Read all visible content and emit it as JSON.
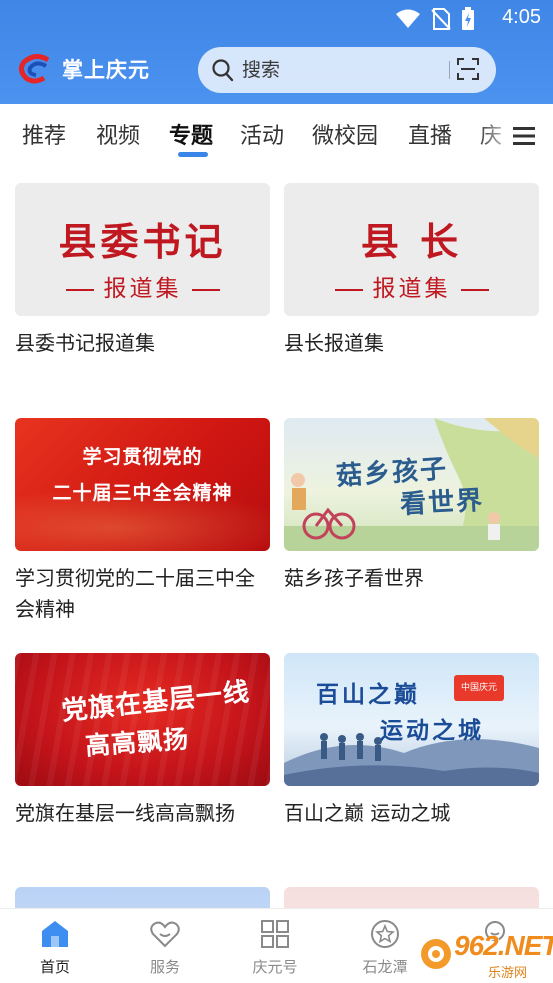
{
  "status_bar": {
    "time": "4:05"
  },
  "app": {
    "title": "掌上庆元"
  },
  "search": {
    "placeholder": "搜索"
  },
  "tabs": [
    {
      "label": "推荐"
    },
    {
      "label": "视频"
    },
    {
      "label": "专题",
      "active": true
    },
    {
      "label": "活动"
    },
    {
      "label": "微校园"
    },
    {
      "label": "直播"
    },
    {
      "label": "庆"
    }
  ],
  "cards": [
    {
      "title": "县委书记报道集",
      "thumb_main": "县委书记",
      "thumb_sub": "报道集"
    },
    {
      "title": "县长报道集",
      "thumb_main": "县 长",
      "thumb_sub": "报道集"
    },
    {
      "title": "学习贯彻党的二十届三中全会精神",
      "thumb_line1": "学习贯彻党的",
      "thumb_line2": "二十届三中全会精神"
    },
    {
      "title": "菇乡孩子看世界",
      "thumb_line1": "菇乡孩子",
      "thumb_line2": "看世界"
    },
    {
      "title": "党旗在基层一线高高飘扬",
      "thumb_line1": "党旗在基层一线",
      "thumb_line2": "高高飘扬"
    },
    {
      "title": "百山之巅 运动之城",
      "thumb_line1": "百山之巅",
      "thumb_line2": "运动之城",
      "badge": "中国庆元"
    }
  ],
  "bottom_nav": [
    {
      "label": "首页",
      "icon": "home-icon",
      "active": true
    },
    {
      "label": "服务",
      "icon": "heart-icon"
    },
    {
      "label": "庆元号",
      "icon": "grid-icon"
    },
    {
      "label": "石龙潭",
      "icon": "star-circle-icon"
    },
    {
      "label": "",
      "icon": "smile-icon"
    }
  ],
  "watermark": {
    "brand": "962.NET",
    "sub": "乐游网"
  },
  "colors": {
    "brand_blue": "#4a8eee",
    "accent_red": "#c01820",
    "tab_indicator": "#3a86e8"
  }
}
